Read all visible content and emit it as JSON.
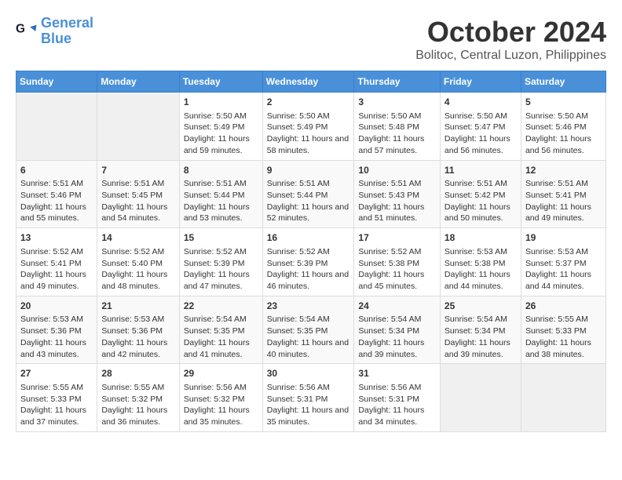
{
  "header": {
    "logo_line1": "General",
    "logo_line2": "Blue",
    "month": "October 2024",
    "location": "Bolitoc, Central Luzon, Philippines"
  },
  "days_of_week": [
    "Sunday",
    "Monday",
    "Tuesday",
    "Wednesday",
    "Thursday",
    "Friday",
    "Saturday"
  ],
  "weeks": [
    [
      {
        "day": "",
        "sunrise": "",
        "sunset": "",
        "daylight": "",
        "empty": true
      },
      {
        "day": "",
        "sunrise": "",
        "sunset": "",
        "daylight": "",
        "empty": true
      },
      {
        "day": "1",
        "sunrise": "Sunrise: 5:50 AM",
        "sunset": "Sunset: 5:49 PM",
        "daylight": "Daylight: 11 hours and 59 minutes."
      },
      {
        "day": "2",
        "sunrise": "Sunrise: 5:50 AM",
        "sunset": "Sunset: 5:49 PM",
        "daylight": "Daylight: 11 hours and 58 minutes."
      },
      {
        "day": "3",
        "sunrise": "Sunrise: 5:50 AM",
        "sunset": "Sunset: 5:48 PM",
        "daylight": "Daylight: 11 hours and 57 minutes."
      },
      {
        "day": "4",
        "sunrise": "Sunrise: 5:50 AM",
        "sunset": "Sunset: 5:47 PM",
        "daylight": "Daylight: 11 hours and 56 minutes."
      },
      {
        "day": "5",
        "sunrise": "Sunrise: 5:50 AM",
        "sunset": "Sunset: 5:46 PM",
        "daylight": "Daylight: 11 hours and 56 minutes."
      }
    ],
    [
      {
        "day": "6",
        "sunrise": "Sunrise: 5:51 AM",
        "sunset": "Sunset: 5:46 PM",
        "daylight": "Daylight: 11 hours and 55 minutes."
      },
      {
        "day": "7",
        "sunrise": "Sunrise: 5:51 AM",
        "sunset": "Sunset: 5:45 PM",
        "daylight": "Daylight: 11 hours and 54 minutes."
      },
      {
        "day": "8",
        "sunrise": "Sunrise: 5:51 AM",
        "sunset": "Sunset: 5:44 PM",
        "daylight": "Daylight: 11 hours and 53 minutes."
      },
      {
        "day": "9",
        "sunrise": "Sunrise: 5:51 AM",
        "sunset": "Sunset: 5:44 PM",
        "daylight": "Daylight: 11 hours and 52 minutes."
      },
      {
        "day": "10",
        "sunrise": "Sunrise: 5:51 AM",
        "sunset": "Sunset: 5:43 PM",
        "daylight": "Daylight: 11 hours and 51 minutes."
      },
      {
        "day": "11",
        "sunrise": "Sunrise: 5:51 AM",
        "sunset": "Sunset: 5:42 PM",
        "daylight": "Daylight: 11 hours and 50 minutes."
      },
      {
        "day": "12",
        "sunrise": "Sunrise: 5:51 AM",
        "sunset": "Sunset: 5:41 PM",
        "daylight": "Daylight: 11 hours and 49 minutes."
      }
    ],
    [
      {
        "day": "13",
        "sunrise": "Sunrise: 5:52 AM",
        "sunset": "Sunset: 5:41 PM",
        "daylight": "Daylight: 11 hours and 49 minutes."
      },
      {
        "day": "14",
        "sunrise": "Sunrise: 5:52 AM",
        "sunset": "Sunset: 5:40 PM",
        "daylight": "Daylight: 11 hours and 48 minutes."
      },
      {
        "day": "15",
        "sunrise": "Sunrise: 5:52 AM",
        "sunset": "Sunset: 5:39 PM",
        "daylight": "Daylight: 11 hours and 47 minutes."
      },
      {
        "day": "16",
        "sunrise": "Sunrise: 5:52 AM",
        "sunset": "Sunset: 5:39 PM",
        "daylight": "Daylight: 11 hours and 46 minutes."
      },
      {
        "day": "17",
        "sunrise": "Sunrise: 5:52 AM",
        "sunset": "Sunset: 5:38 PM",
        "daylight": "Daylight: 11 hours and 45 minutes."
      },
      {
        "day": "18",
        "sunrise": "Sunrise: 5:53 AM",
        "sunset": "Sunset: 5:38 PM",
        "daylight": "Daylight: 11 hours and 44 minutes."
      },
      {
        "day": "19",
        "sunrise": "Sunrise: 5:53 AM",
        "sunset": "Sunset: 5:37 PM",
        "daylight": "Daylight: 11 hours and 44 minutes."
      }
    ],
    [
      {
        "day": "20",
        "sunrise": "Sunrise: 5:53 AM",
        "sunset": "Sunset: 5:36 PM",
        "daylight": "Daylight: 11 hours and 43 minutes."
      },
      {
        "day": "21",
        "sunrise": "Sunrise: 5:53 AM",
        "sunset": "Sunset: 5:36 PM",
        "daylight": "Daylight: 11 hours and 42 minutes."
      },
      {
        "day": "22",
        "sunrise": "Sunrise: 5:54 AM",
        "sunset": "Sunset: 5:35 PM",
        "daylight": "Daylight: 11 hours and 41 minutes."
      },
      {
        "day": "23",
        "sunrise": "Sunrise: 5:54 AM",
        "sunset": "Sunset: 5:35 PM",
        "daylight": "Daylight: 11 hours and 40 minutes."
      },
      {
        "day": "24",
        "sunrise": "Sunrise: 5:54 AM",
        "sunset": "Sunset: 5:34 PM",
        "daylight": "Daylight: 11 hours and 39 minutes."
      },
      {
        "day": "25",
        "sunrise": "Sunrise: 5:54 AM",
        "sunset": "Sunset: 5:34 PM",
        "daylight": "Daylight: 11 hours and 39 minutes."
      },
      {
        "day": "26",
        "sunrise": "Sunrise: 5:55 AM",
        "sunset": "Sunset: 5:33 PM",
        "daylight": "Daylight: 11 hours and 38 minutes."
      }
    ],
    [
      {
        "day": "27",
        "sunrise": "Sunrise: 5:55 AM",
        "sunset": "Sunset: 5:33 PM",
        "daylight": "Daylight: 11 hours and 37 minutes."
      },
      {
        "day": "28",
        "sunrise": "Sunrise: 5:55 AM",
        "sunset": "Sunset: 5:32 PM",
        "daylight": "Daylight: 11 hours and 36 minutes."
      },
      {
        "day": "29",
        "sunrise": "Sunrise: 5:56 AM",
        "sunset": "Sunset: 5:32 PM",
        "daylight": "Daylight: 11 hours and 35 minutes."
      },
      {
        "day": "30",
        "sunrise": "Sunrise: 5:56 AM",
        "sunset": "Sunset: 5:31 PM",
        "daylight": "Daylight: 11 hours and 35 minutes."
      },
      {
        "day": "31",
        "sunrise": "Sunrise: 5:56 AM",
        "sunset": "Sunset: 5:31 PM",
        "daylight": "Daylight: 11 hours and 34 minutes."
      },
      {
        "day": "",
        "sunrise": "",
        "sunset": "",
        "daylight": "",
        "empty": true
      },
      {
        "day": "",
        "sunrise": "",
        "sunset": "",
        "daylight": "",
        "empty": true
      }
    ]
  ]
}
